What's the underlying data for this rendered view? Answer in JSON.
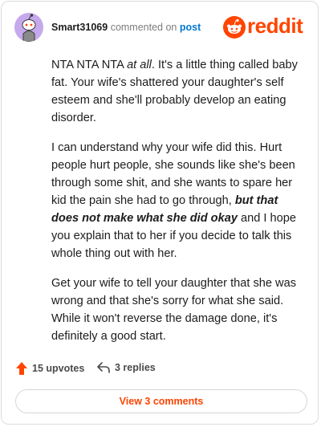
{
  "comment": {
    "username": "Smart31069",
    "verb": "commented on",
    "post_link": "post",
    "paragraphs": [
      {
        "p1_prefix": "NTA NTA NTA ",
        "p1_italic": "at all",
        "p1_suffix": ". It's a little thing called baby fat. Your wife's shattered your daughter's self esteem and she'll probably develop an eating disorder."
      },
      {
        "p2_prefix": "I can understand why your wife did this. Hurt people hurt people, she sounds like she's been through some shit, and she wants to spare her kid the pain she had to go through, ",
        "p2_emph": "but that does not make what she did okay",
        "p2_suffix": " and I hope you explain that to her if you decide to talk this whole thing out with her."
      },
      {
        "p3": "Get your wife to tell your daughter that she was wrong and that she's sorry for what she said. While it won't reverse the damage done, it's definitely a good start."
      }
    ]
  },
  "brand": {
    "wordmark": "reddit",
    "color": "#ff4500"
  },
  "actions": {
    "upvotes": "15 upvotes",
    "replies": "3 replies"
  },
  "footer": {
    "view_comments": "View 3 comments"
  }
}
